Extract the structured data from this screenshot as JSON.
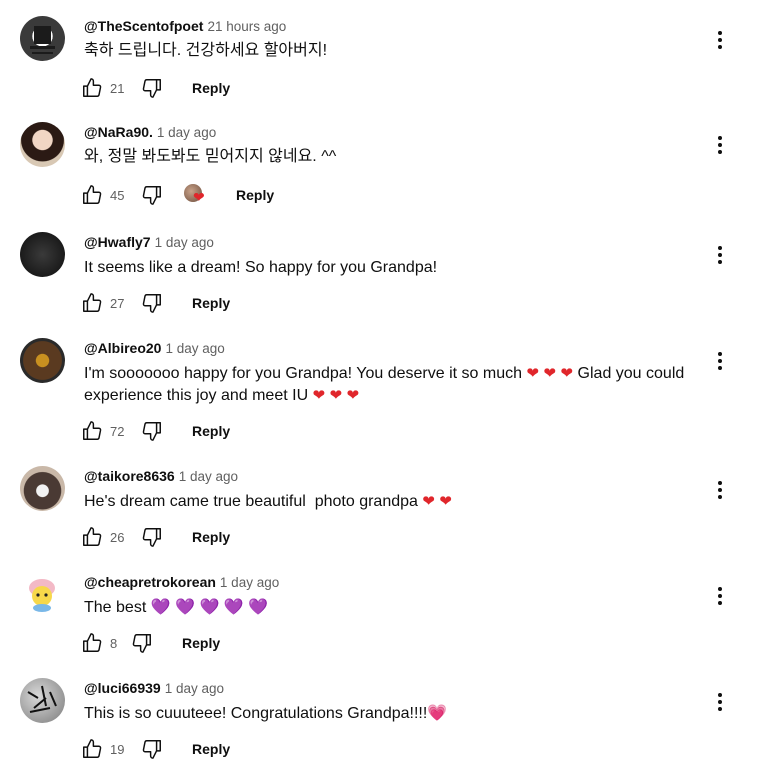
{
  "reply_label": "Reply",
  "colors": {
    "heart": "#e0262b",
    "purple_heart": "#9b3fd1",
    "pink_heart": "#ef6fa8",
    "meta": "#606060"
  },
  "icons": {
    "like": "thumbs-up-icon",
    "dislike": "thumbs-down-icon",
    "menu": "more-vert-icon",
    "creator_heart": "creator-heart-icon"
  },
  "comments": [
    {
      "author": "@TheScentofpoet",
      "time": "21 hours ago",
      "text": "축하 드립니다. 건강하세요 할아버지!",
      "likes": "21"
    },
    {
      "author": "@NaRa90.",
      "time": "1 day ago",
      "text": "와, 정말 봐도봐도 믿어지지 않네요. ^^",
      "likes": "45",
      "creator_hearted": true
    },
    {
      "author": "@Hwafly7",
      "time": "1 day ago",
      "text": "It seems like a dream! So happy for you Grandpa!",
      "likes": "27"
    },
    {
      "author": "@Albireo20",
      "time": "1 day ago",
      "text_part1": "I'm sooooooo happy for you Grandpa! You deserve it so much ",
      "text_part2": " Glad you could experience this joy and meet IU ",
      "likes": "72"
    },
    {
      "author": "@taikore8636",
      "time": "1 day ago",
      "text": "He's dream came true beautiful  photo grandpa ",
      "likes": "26"
    },
    {
      "author": "@cheapretrokorean",
      "time": "1 day ago",
      "text": "The best ",
      "likes": "8"
    },
    {
      "author": "@luci66939",
      "time": "1 day ago",
      "text": "This is so cuuuteee! Congratulations Grandpa!!!!",
      "likes": "19"
    }
  ],
  "emoji": {
    "red_heart": "❤",
    "purple_heart": "💜",
    "pink_heart": "💗"
  }
}
